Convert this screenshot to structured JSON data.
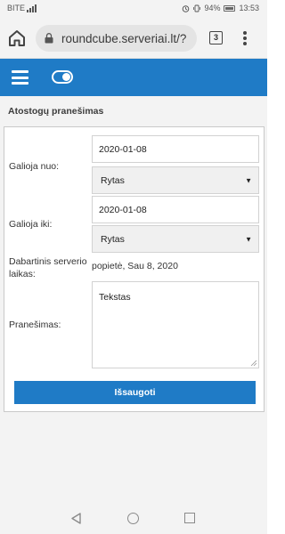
{
  "status_bar": {
    "carrier": "BITE",
    "battery": "94%",
    "time": "13:53"
  },
  "browser": {
    "url": "roundcube.serveriai.lt/?",
    "tab_count": "3"
  },
  "section": {
    "title": "Atostogų pranešimas"
  },
  "form": {
    "valid_from_label": "Galioja nuo:",
    "valid_from_date": "2020-01-08",
    "valid_from_time": "Rytas",
    "valid_to_label": "Galioja iki:",
    "valid_to_date": "2020-01-08",
    "valid_to_time": "Rytas",
    "server_time_label_1": "Dabartinis serverio",
    "server_time_label_2": "laikas:",
    "server_time_value": "popietė, Sau 8, 2020",
    "message_label": "Pranešimas:",
    "message_value": "Tekstas",
    "save_label": "Išsaugoti"
  },
  "colors": {
    "accent": "#1f7bc6",
    "background": "#f3f3f3"
  },
  "icons": {
    "home": "home-icon",
    "lock": "lock-icon",
    "tabs": "tabs-icon",
    "more": "more-vert-icon",
    "menu": "hamburger-icon",
    "toggle": "toggle-icon",
    "caret": "caret-down-icon",
    "back": "nav-back-icon",
    "nav_home": "nav-home-icon",
    "recent": "nav-recent-icon"
  }
}
